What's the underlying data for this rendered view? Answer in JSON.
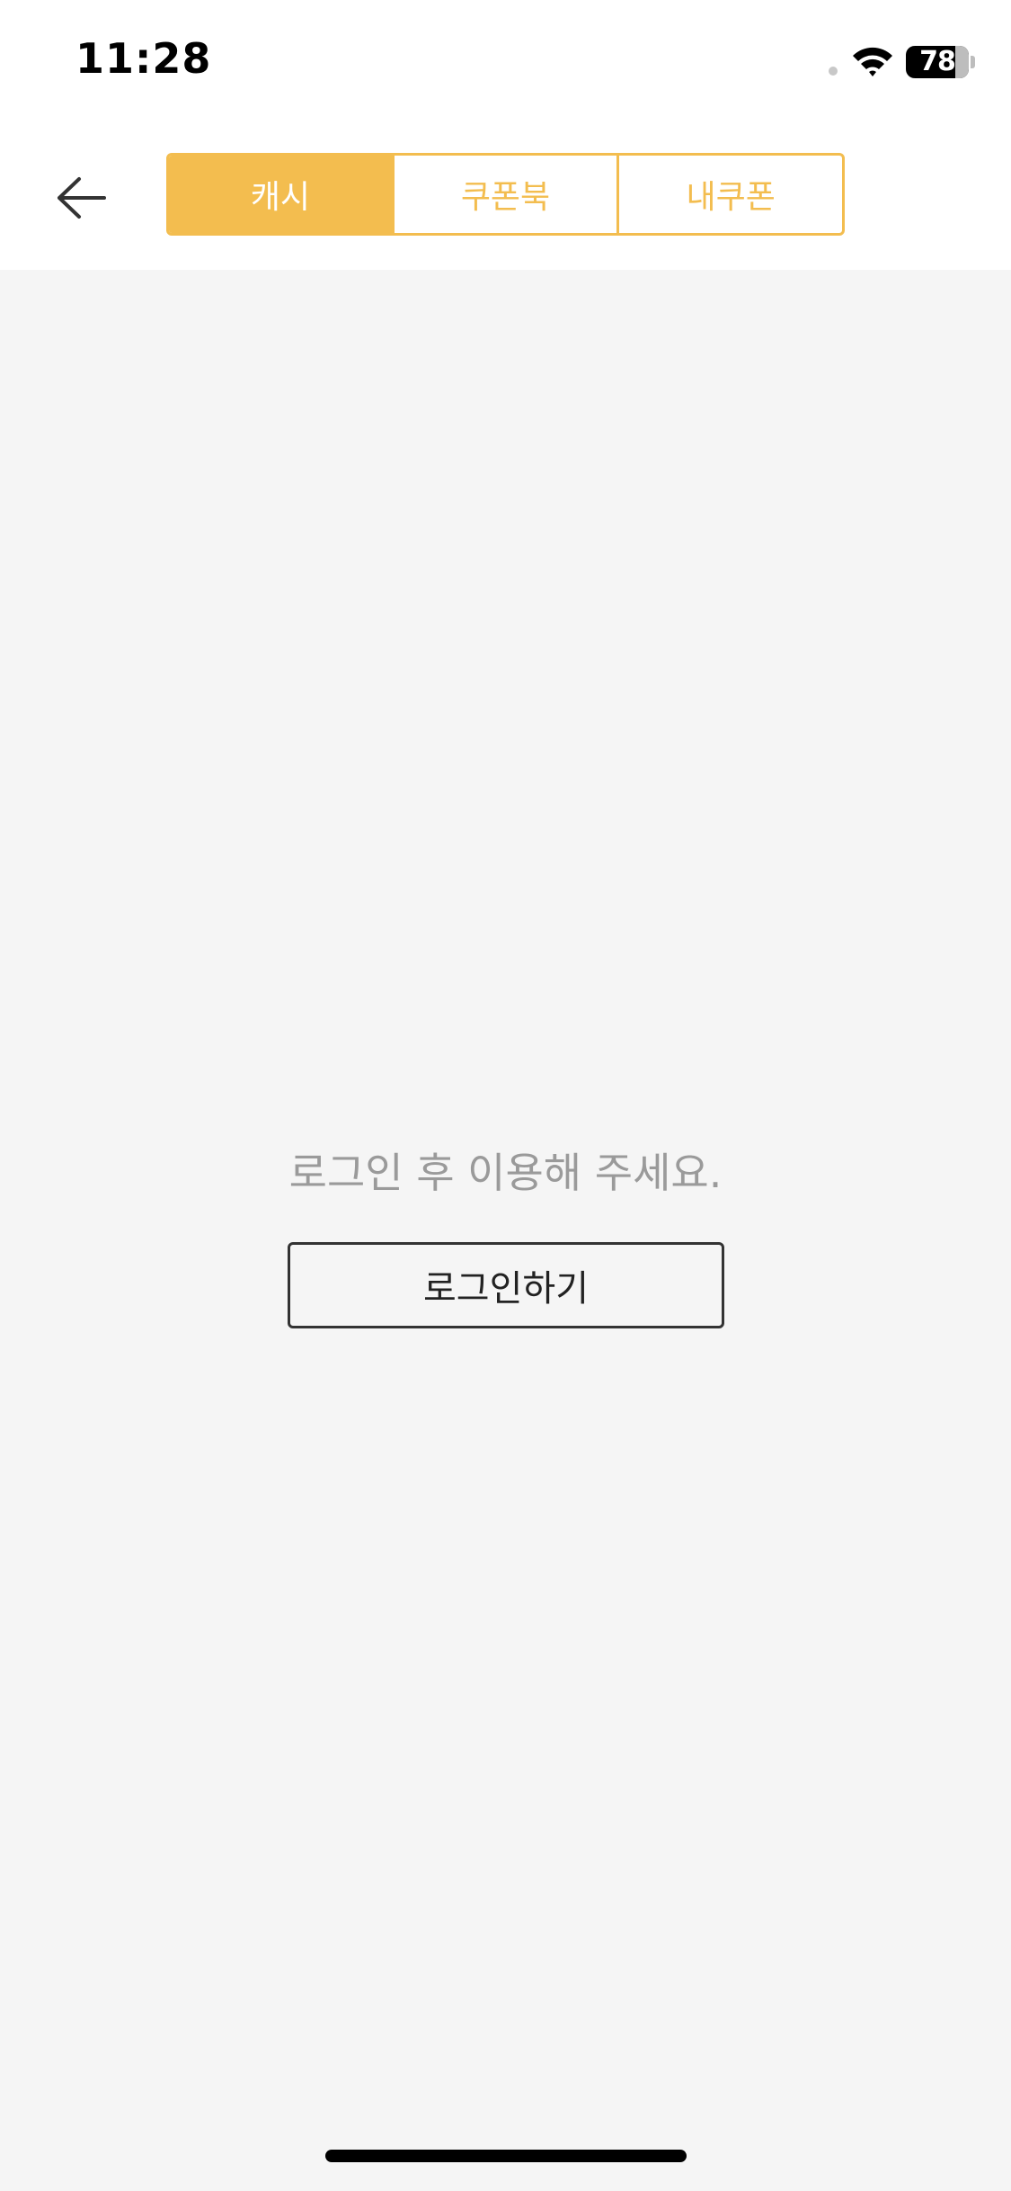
{
  "status_bar": {
    "time": "11:28",
    "battery_level": "78",
    "icons": [
      "dot-indicator",
      "wifi-icon",
      "battery-icon"
    ]
  },
  "nav": {
    "back_icon": "arrow-left-icon",
    "tabs": [
      {
        "label": "캐시",
        "active": true
      },
      {
        "label": "쿠폰북",
        "active": false
      },
      {
        "label": "내쿠폰",
        "active": false
      }
    ]
  },
  "main": {
    "message": "로그인 후 이용해 주세요.",
    "login_button_label": "로그인하기"
  },
  "colors": {
    "accent": "#f3bd4f",
    "background": "#f5f5f5",
    "message_text": "#9a9a9a",
    "button_border": "#333333"
  }
}
